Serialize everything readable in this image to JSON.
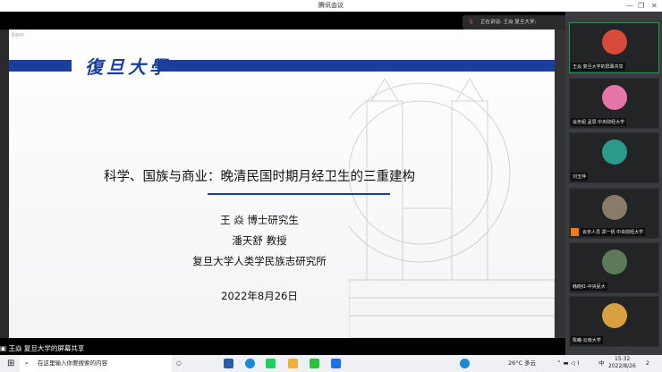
{
  "window": {
    "title": "腾讯会议",
    "min": "—",
    "max": "❐",
    "close": "✕"
  },
  "speaking": {
    "label": "正在讲话: 王焱 复旦大学;"
  },
  "slide": {
    "recording": "录制中",
    "logo": "復旦大學",
    "title": "科学、国族与商业：晚清民国时期月经卫生的三重建构",
    "author": "王 焱 博士研究生",
    "advisor": "潘天舒 教授",
    "institution": "复旦大学人类学民族志研究所",
    "date": "2022年8月26日"
  },
  "participants": [
    {
      "name": "王焱 复旦大学的屏幕共享",
      "color": "#d84a3a"
    },
    {
      "name": "会务组 孟思 中央财经大学",
      "color": "#e574a8"
    },
    {
      "name": "刘玉萍",
      "color": "#2a9a8a"
    },
    {
      "name": "会务人员 郑一帆 中央财经大学",
      "color": "#8a7a6a"
    },
    {
      "name": "韩晓红-中央民大",
      "color": "#5a7a5a"
    },
    {
      "name": "陈曦-云南大学",
      "color": "#d8a040"
    }
  ],
  "share_label": "王焱 复旦大学的屏幕共享",
  "taskbar": {
    "search_placeholder": "在这里输入你要搜索的内容",
    "weather": "26°C 多云",
    "ime": "中",
    "time": "15:32",
    "date": "2022/8/26",
    "notifications": "2"
  }
}
